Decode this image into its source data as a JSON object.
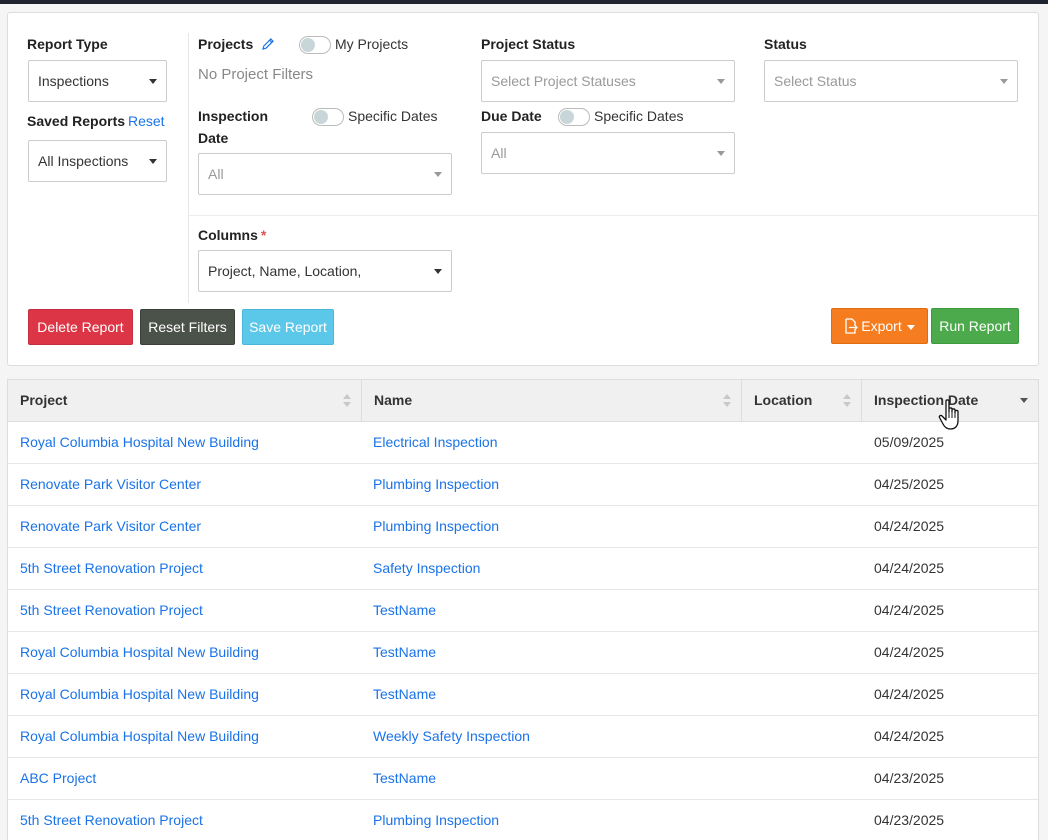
{
  "filters": {
    "report_type": {
      "label": "Report Type",
      "value": "Inspections"
    },
    "saved_reports": {
      "label": "Saved Reports",
      "reset_label": "Reset",
      "value": "All Inspections"
    },
    "projects": {
      "label": "Projects",
      "my_projects_label": "My Projects",
      "empty_text": "No Project Filters"
    },
    "inspection_date": {
      "label_line1": "Inspection",
      "label_line2": "Date",
      "specific_dates_label": "Specific Dates",
      "value": "All"
    },
    "project_status": {
      "label": "Project Status",
      "placeholder": "Select Project Statuses"
    },
    "due_date": {
      "label": "Due Date",
      "specific_dates_label": "Specific Dates",
      "value": "All"
    },
    "status": {
      "label": "Status",
      "placeholder": "Select Status"
    },
    "columns": {
      "label": "Columns",
      "required_mark": "*",
      "value": "Project, Name, Location,"
    }
  },
  "actions": {
    "delete_label": "Delete Report",
    "reset_filters_label": "Reset Filters",
    "save_label": "Save Report",
    "export_label": "Export",
    "run_label": "Run Report"
  },
  "table": {
    "headers": [
      "Project",
      "Name",
      "Location",
      "Inspection Date"
    ],
    "sorted_column": "Inspection Date",
    "sort_direction": "descending",
    "rows": [
      {
        "project": "Royal Columbia Hospital New Building",
        "name": "Electrical Inspection",
        "location": "",
        "date": "05/09/2025"
      },
      {
        "project": "Renovate Park Visitor Center",
        "name": "Plumbing Inspection",
        "location": "",
        "date": "04/25/2025"
      },
      {
        "project": "Renovate Park Visitor Center",
        "name": "Plumbing Inspection",
        "location": "",
        "date": "04/24/2025"
      },
      {
        "project": "5th Street Renovation Project",
        "name": "Safety Inspection",
        "location": "",
        "date": "04/24/2025"
      },
      {
        "project": "5th Street Renovation Project",
        "name": "TestName",
        "location": "",
        "date": "04/24/2025"
      },
      {
        "project": "Royal Columbia Hospital New Building",
        "name": "TestName",
        "location": "",
        "date": "04/24/2025"
      },
      {
        "project": "Royal Columbia Hospital New Building",
        "name": "TestName",
        "location": "",
        "date": "04/24/2025"
      },
      {
        "project": "Royal Columbia Hospital New Building",
        "name": "Weekly Safety Inspection",
        "location": "",
        "date": "04/24/2025"
      },
      {
        "project": "ABC Project",
        "name": "TestName",
        "location": "",
        "date": "04/23/2025"
      },
      {
        "project": "5th Street Renovation Project",
        "name": "Plumbing Inspection",
        "location": "",
        "date": "04/23/2025"
      }
    ]
  },
  "colors": {
    "link": "#1a73e8",
    "delete": "#dc3545",
    "reset": "#4b5249",
    "save": "#5bc8ea",
    "export": "#f57c1f",
    "run": "#4caa4c"
  },
  "icons": [
    "pencil-icon",
    "file-export-icon",
    "hand-pointer-cursor"
  ]
}
